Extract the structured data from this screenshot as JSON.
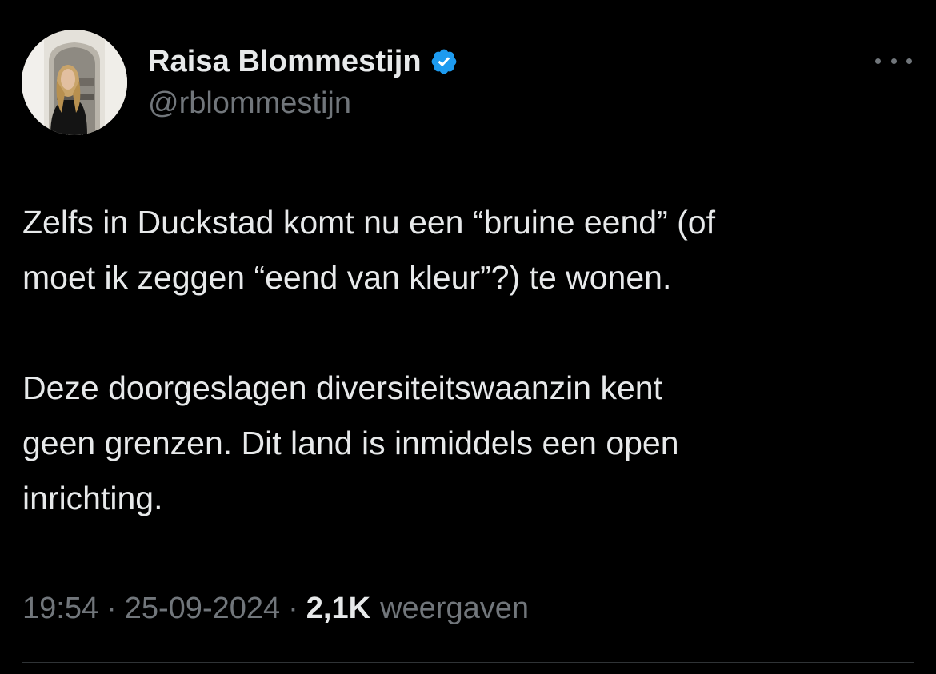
{
  "tweet": {
    "author": {
      "name": "Raisa Blommestijn",
      "handle": "@rblommestijn",
      "verified_icon": "verified-badge-icon",
      "verified_color": "#1d9bf0"
    },
    "text_lines": [
      "Zelfs in Duckstad komt nu een “bruine eend” (of",
      "moet ik zeggen “eend van kleur”?) te wonen.",
      "Deze doorgeslagen diversiteitswaanzin kent",
      "geen grenzen. Dit land is inmiddels een open",
      "inrichting."
    ],
    "meta": {
      "time": "19:54",
      "separator": "·",
      "date": "25-09-2024",
      "views_count": "2,1K",
      "views_label": "weergaven"
    },
    "more_icon": "more-dots-icon"
  },
  "colors": {
    "background": "#000000",
    "primary_text": "#e7e9ea",
    "secondary_text": "#71767b",
    "divider": "#2f3336",
    "accent": "#1d9bf0"
  }
}
